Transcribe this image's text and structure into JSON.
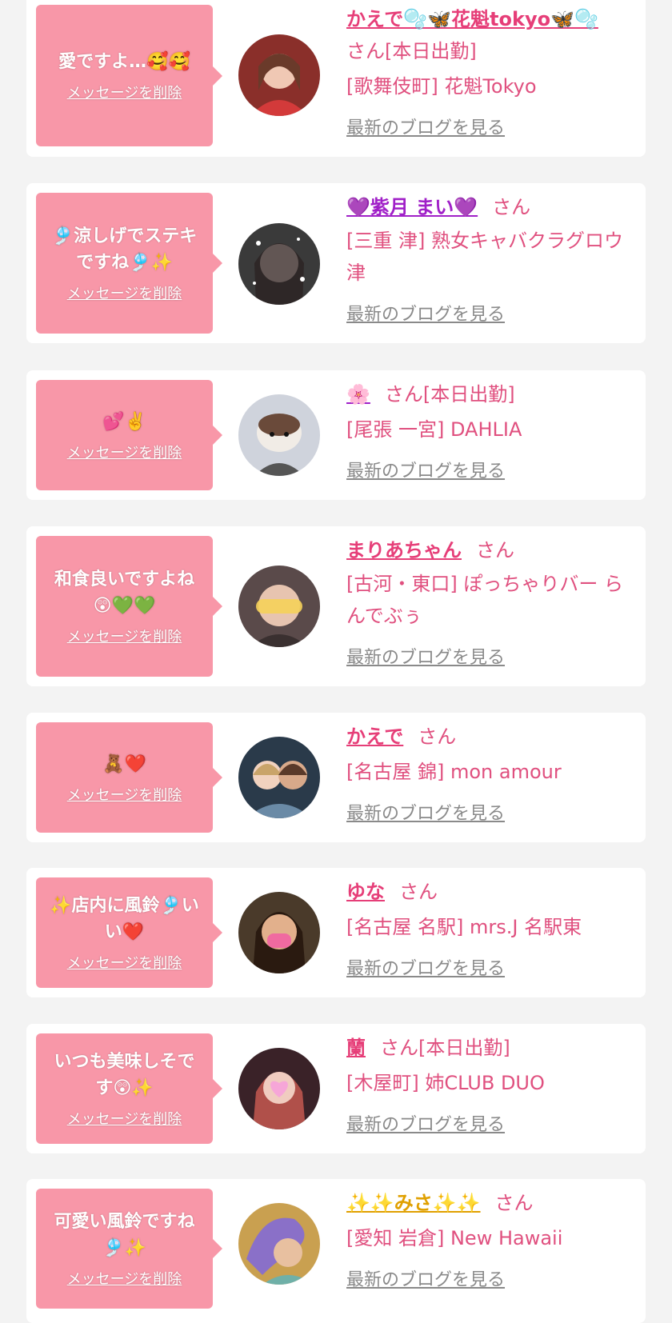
{
  "delete_label": "メッセージを削除",
  "blog_label": "最新のブログを見る",
  "honorific": "さん",
  "colors": {
    "bubble": "#f897a8",
    "name": "#e63e78",
    "shop": "#e0507f",
    "blog": "#8a8a8a",
    "background": "#f3f3f3"
  },
  "cards": [
    {
      "message": "愛ですよ…🥰🥰",
      "name": "かえで🫧🦋花魁tokyo🦋🫧",
      "suffix": "さん[本日出勤]",
      "shop": "[歌舞伎町] 花魁Tokyo",
      "avatar_icon": "woman-red-dress-photo"
    },
    {
      "message": "🎐涼しげでステキ\nですね🎐✨",
      "name": "💜紫月 まい💜",
      "suffix": "さん",
      "shop": "[三重 津] 熟女キャバクラグロウ津",
      "avatar_icon": "woman-sparkle-photo"
    },
    {
      "message": "💕✌️",
      "name": "🌸",
      "suffix": "さん[本日出勤]",
      "shop": "[尾張 一宮] DAHLIA",
      "avatar_icon": "hamster-photo"
    },
    {
      "message": "和食良いですよね\n😲💚💚",
      "name": "まりあちゃん",
      "suffix": "さん",
      "shop": "[古河・東口] ぽっちゃりバー らんでぶぅ",
      "avatar_icon": "happy-stamp-photo"
    },
    {
      "message": "🧸❤️",
      "name": "かえで",
      "suffix": "さん",
      "shop": "[名古屋 錦] mon amour",
      "avatar_icon": "two-women-photo"
    },
    {
      "message": "✨店内に風鈴🎐い\nい❤️",
      "name": "ゆな",
      "suffix": "さん",
      "shop": "[名古屋 名駅] mrs.J 名駅東",
      "avatar_icon": "thank-you-mask-photo"
    },
    {
      "message": "いつも美味しそで\nす😲✨",
      "name": "蘭",
      "suffix": "さん[本日出勤]",
      "shop": "[木屋町] 姉CLUB DUO",
      "avatar_icon": "heart-face-photo"
    },
    {
      "message": "可愛い風鈴ですね\n🎐✨",
      "name": "✨✨みさ✨✨",
      "suffix": "さん",
      "shop": "[愛知 岩倉] New Hawaii",
      "avatar_icon": "purple-hair-photo"
    }
  ]
}
